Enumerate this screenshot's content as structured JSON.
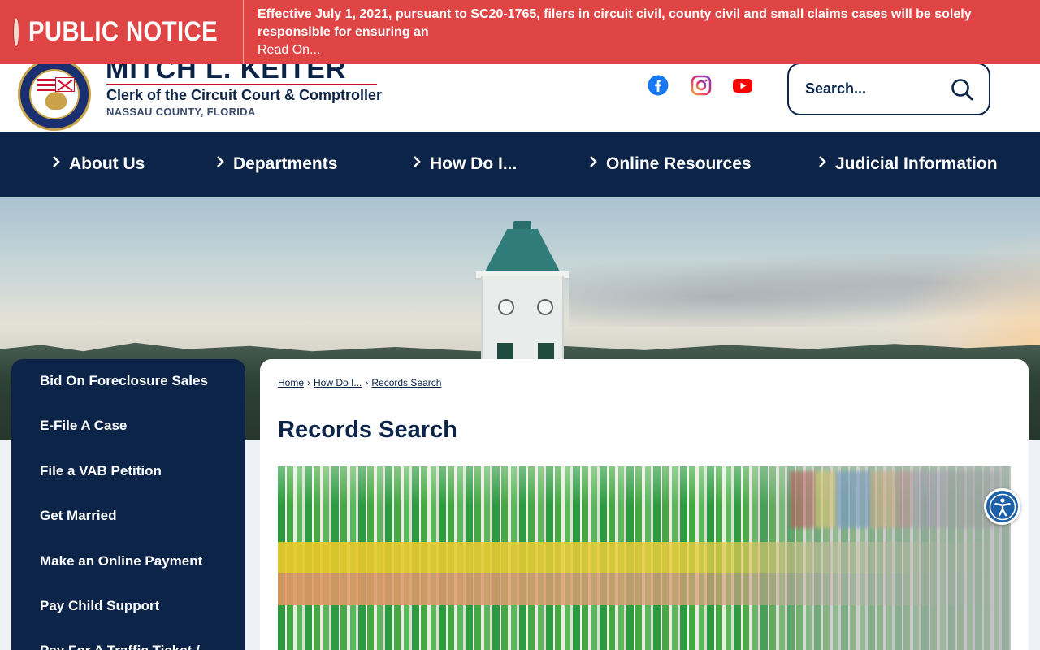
{
  "alert": {
    "title": "PUBLIC NOTICE",
    "message": "Effective July 1, 2021, pursuant to SC20-1765, filers in circuit civil, county civil and small claims cases will be solely responsible for ensuring an",
    "link": "Read On..."
  },
  "header": {
    "name": "MITCH L. KEITER",
    "subtitle": "Clerk of the Circuit Court & Comptroller",
    "county": "NASSAU COUNTY, FLORIDA",
    "social": [
      "facebook-icon",
      "instagram-icon",
      "youtube-icon"
    ],
    "search_placeholder": "Search..."
  },
  "nav": {
    "items": [
      {
        "label": "About Us"
      },
      {
        "label": "Departments"
      },
      {
        "label": "How Do I..."
      },
      {
        "label": "Online Resources"
      },
      {
        "label": "Judicial Information"
      }
    ]
  },
  "sidebar": {
    "items": [
      {
        "label": "Bid On Foreclosure Sales"
      },
      {
        "label": "E-File A Case"
      },
      {
        "label": "File a VAB Petition"
      },
      {
        "label": "Get Married"
      },
      {
        "label": "Make an Online Payment"
      },
      {
        "label": "Pay Child Support"
      },
      {
        "label": "Pay For A Traffic Ticket /"
      }
    ]
  },
  "breadcrumb": {
    "home": "Home",
    "how": "How Do I...",
    "current": "Records Search"
  },
  "page": {
    "title": "Records Search"
  },
  "colors": {
    "navy": "#0b2447",
    "alert_red": "#e04545",
    "brand_red": "#c8102e"
  }
}
